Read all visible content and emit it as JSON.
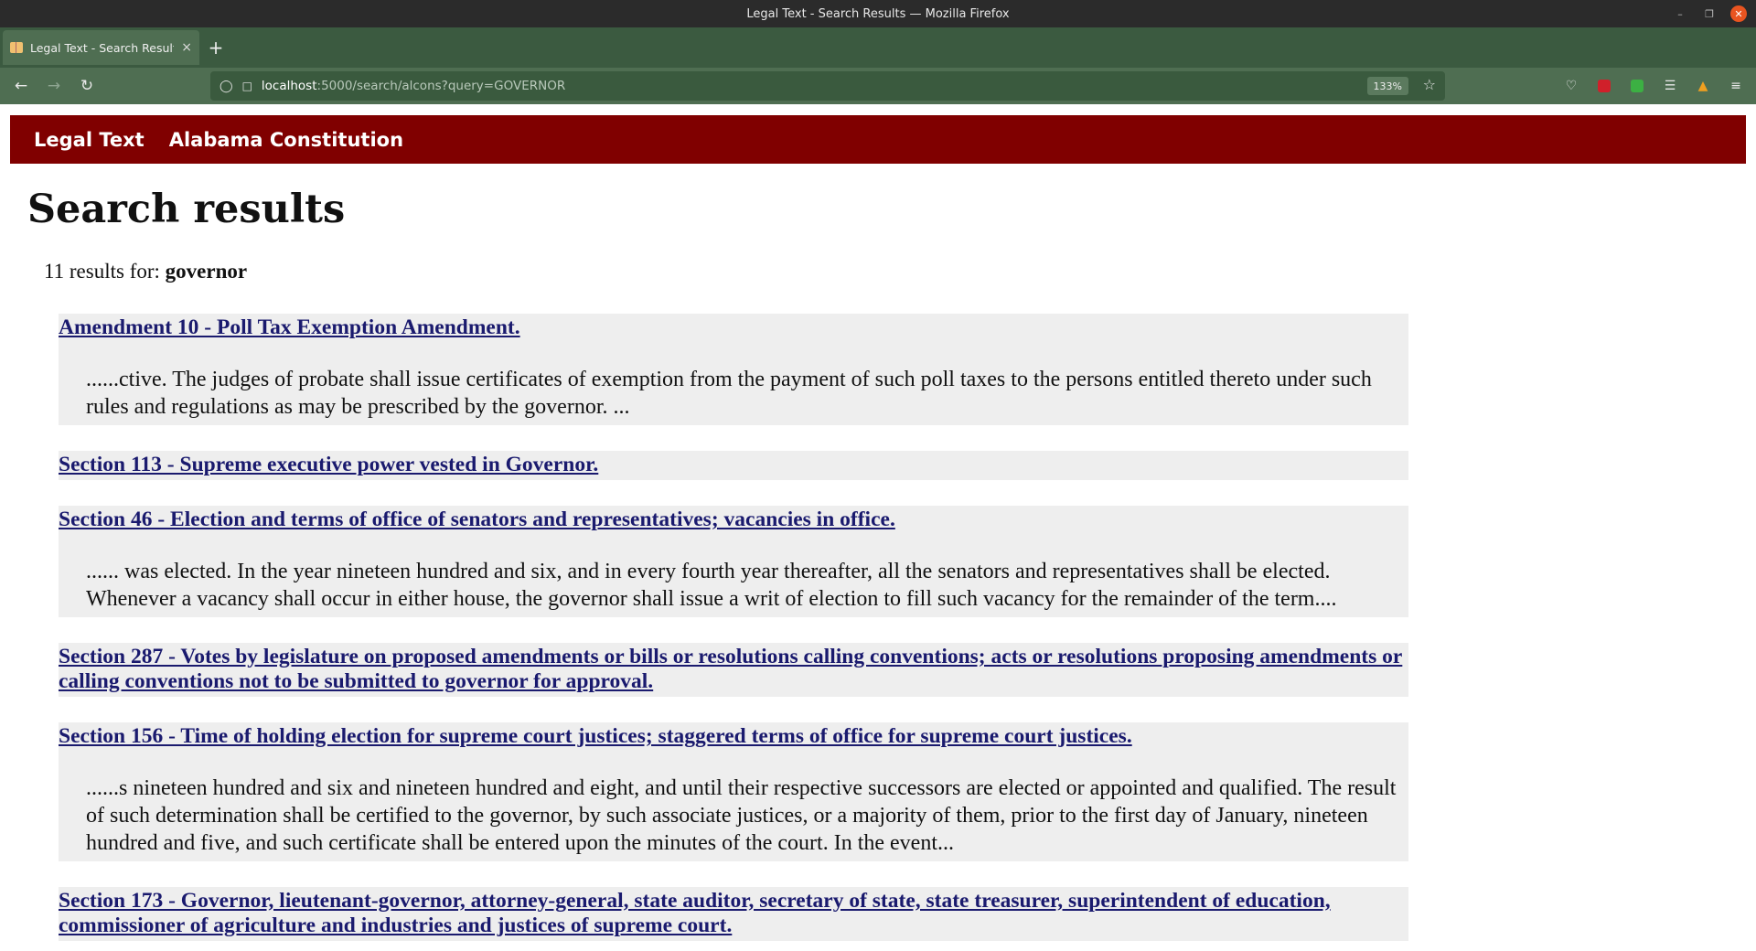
{
  "window": {
    "title": "Legal Text - Search Results — Mozilla Firefox"
  },
  "tab": {
    "title": "Legal Text - Search Results",
    "close": "×",
    "new_tab": "+"
  },
  "navbar": {
    "url_host": "localhost",
    "url_rest": ":5000/search/alcons?query=GOVERNOR",
    "zoom": "133%"
  },
  "site": {
    "brand": "Legal Text",
    "section": "Alabama Constitution",
    "header_color": "#800000"
  },
  "page": {
    "title": "Search results",
    "summary_prefix": "11 results for: ",
    "query": "governor"
  },
  "results": [
    {
      "title": "Amendment 10 - Poll Tax Exemption Amendment.",
      "snippet": "......ctive. The judges of probate shall issue certificates of exemption from the payment of such poll taxes to the persons entitled thereto under such rules and regulations as may be prescribed by the governor. ..."
    },
    {
      "title": "Section 113 - Supreme executive power vested in Governor.",
      "snippet": ""
    },
    {
      "title": "Section 46 - Election and terms of office of senators and representatives; vacancies in office.",
      "snippet": "...... was elected. In the year nineteen hundred and six, and in every fourth year thereafter, all the senators and representatives shall be elected. Whenever a vacancy shall occur in either house, the governor shall issue a writ of election to fill such vacancy for the remainder of the term...."
    },
    {
      "title": "Section 287 - Votes by legislature on proposed amendments or bills or resolutions calling conventions; acts or resolutions proposing amendments or calling conventions not to be submitted to governor for approval.",
      "snippet": ""
    },
    {
      "title": "Section 156 - Time of holding election for supreme court justices; staggered terms of office for supreme court justices.",
      "snippet": "......s nineteen hundred and six and nineteen hundred and eight, and until their respective successors are elected or appointed and qualified. The result of such determination shall be certified to the governor, by such associate justices, or a majority of them, prior to the first day of January, nineteen hundred and five, and such certificate shall be entered upon the minutes of the court. In the event..."
    },
    {
      "title": "Section 173 - Governor, lieutenant-governor, attorney-general, state auditor, secretary of state, state treasurer, superintendent of education, commissioner of agriculture and industries and justices of supreme court.",
      "snippet": ""
    }
  ]
}
